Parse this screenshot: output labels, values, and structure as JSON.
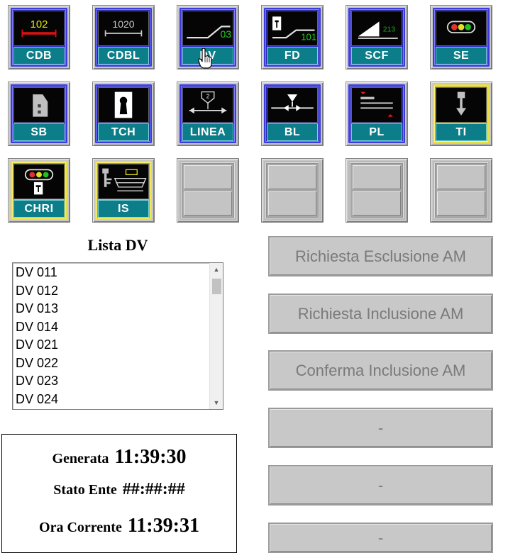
{
  "tiles": [
    {
      "label": "CDB",
      "icon": "track-circuit-icon",
      "style": "blue",
      "screen_text": "102",
      "screen_color": "#e8e800"
    },
    {
      "label": "CDBL",
      "icon": "track-circuit-long-icon",
      "style": "blue",
      "screen_text": "1020",
      "screen_color": "#c8c8c8"
    },
    {
      "label": "DV",
      "icon": "switch-icon",
      "style": "blue",
      "screen_text": "03",
      "screen_color": "#20d020"
    },
    {
      "label": "FD",
      "icon": "derailer-icon",
      "style": "blue",
      "screen_text": "101",
      "screen_color": "#20d020"
    },
    {
      "label": "SCF",
      "icon": "scf-icon",
      "style": "blue",
      "screen_text": "213",
      "screen_color": "#20a020"
    },
    {
      "label": "SE",
      "icon": "signal-lights-icon",
      "style": "blue"
    },
    {
      "label": "SB",
      "icon": "signal-board-icon",
      "style": "blue"
    },
    {
      "label": "TCH",
      "icon": "keyhole-icon",
      "style": "blue"
    },
    {
      "label": "LINEA",
      "icon": "line-icon",
      "style": "blue",
      "screen_text": "2",
      "screen_color": "#ffffff"
    },
    {
      "label": "BL",
      "icon": "block-icon",
      "style": "blue"
    },
    {
      "label": "PL",
      "icon": "level-crossing-icon",
      "style": "blue"
    },
    {
      "label": "TI",
      "icon": "ti-icon",
      "style": "yellow"
    },
    {
      "label": "CHRI",
      "icon": "chri-icon",
      "style": "yellow"
    },
    {
      "label": "IS",
      "icon": "key-lock-icon",
      "style": "yellow"
    },
    {
      "label": "",
      "icon": "",
      "style": "empty"
    },
    {
      "label": "",
      "icon": "",
      "style": "empty"
    },
    {
      "label": "",
      "icon": "",
      "style": "empty"
    },
    {
      "label": "",
      "icon": "",
      "style": "empty"
    }
  ],
  "list": {
    "title": "Lista DV",
    "items": [
      "DV 011",
      "DV 012",
      "DV 013",
      "DV 014",
      "DV 021",
      "DV 022",
      "DV 023",
      "DV 024"
    ]
  },
  "actions": [
    {
      "label": "Richiesta Esclusione AM"
    },
    {
      "label": "Richiesta Inclusione AM"
    },
    {
      "label": "Conferma Inclusione AM"
    },
    {
      "label": "-"
    },
    {
      "label": "-"
    },
    {
      "label": "-"
    }
  ],
  "status": {
    "generata_label": "Generata",
    "generata_value": "11:39:30",
    "stato_label": "Stato Ente",
    "stato_value": "##:##:##",
    "ora_label": "Ora Corrente",
    "ora_value": "11:39:31"
  },
  "colors": {
    "tile_blue": "#2828c8",
    "tile_yellow": "#d8d020",
    "tile_label": "#0b7e8a",
    "disabled_text": "#7a7a7a"
  }
}
